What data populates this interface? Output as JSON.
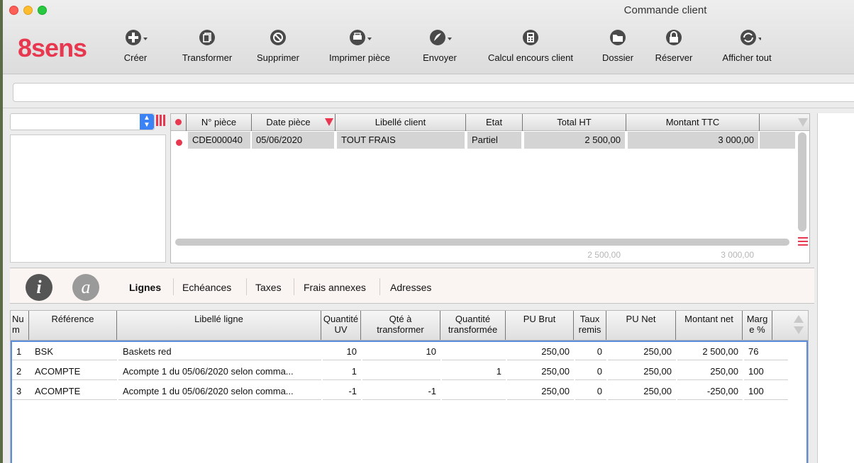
{
  "window": {
    "title": "Commande client"
  },
  "brand": {
    "logo": "8sens",
    "color": "#e8384f"
  },
  "toolbar": [
    {
      "id": "creer",
      "label": "Créer",
      "icon": "plus-circle-icon"
    },
    {
      "id": "transformer",
      "label": "Transformer",
      "icon": "copy-icon"
    },
    {
      "id": "supprimer",
      "label": "Supprimer",
      "icon": "forbidden-icon"
    },
    {
      "id": "imprimer",
      "label": "Imprimer pièce",
      "icon": "printer-icon"
    },
    {
      "id": "envoyer",
      "label": "Envoyer",
      "icon": "send-icon"
    },
    {
      "id": "calcul",
      "label": "Calcul encours client",
      "icon": "calculator-icon"
    },
    {
      "id": "dossier",
      "label": "Dossier",
      "icon": "folder-icon"
    },
    {
      "id": "reserver",
      "label": "Réserver",
      "icon": "lock-icon"
    },
    {
      "id": "afficher",
      "label": "Afficher tout",
      "icon": "refresh-icon"
    }
  ],
  "search": {
    "value": ""
  },
  "filter": {
    "selected": ""
  },
  "orders": {
    "columns": [
      "N° pièce",
      "Date pièce",
      "Libellé client",
      "Etat",
      "Total HT",
      "Montant TTC"
    ],
    "rows": [
      {
        "num": "CDE000040",
        "date": "05/06/2020",
        "client": "TOUT FRAIS",
        "etat": "Partiel",
        "ht": "2 500,00",
        "ttc": "3 000,00"
      }
    ],
    "totals": {
      "ht": "2 500,00",
      "ttc": "3 000,00"
    }
  },
  "tabs": [
    {
      "label": "Lignes",
      "active": true
    },
    {
      "label": "Echéances",
      "active": false
    },
    {
      "label": "Taxes",
      "active": false
    },
    {
      "label": "Frais annexes",
      "active": false
    },
    {
      "label": "Adresses",
      "active": false
    }
  ],
  "info_buttons": {
    "i": "i",
    "a": "a"
  },
  "lines": {
    "columns": [
      {
        "l1": "Nu",
        "l2": "m"
      },
      {
        "l1": "Référence",
        "l2": ""
      },
      {
        "l1": "Libellé ligne",
        "l2": ""
      },
      {
        "l1": "Quantité",
        "l2": "UV"
      },
      {
        "l1": "Qté à",
        "l2": "transformer"
      },
      {
        "l1": "Quantité",
        "l2": "transformée"
      },
      {
        "l1": "PU Brut",
        "l2": ""
      },
      {
        "l1": "Taux",
        "l2": "remis"
      },
      {
        "l1": "PU Net",
        "l2": ""
      },
      {
        "l1": "Montant net",
        "l2": ""
      },
      {
        "l1": "Marg",
        "l2": "e %"
      }
    ],
    "rows": [
      {
        "num": "1",
        "ref": "BSK",
        "lib": "Baskets red",
        "qte": "10",
        "qtt": "10",
        "qtf": "",
        "pub": "250,00",
        "taux": "0",
        "pun": "250,00",
        "mnt": "2 500,00",
        "marge": "76"
      },
      {
        "num": "2",
        "ref": "ACOMPTE",
        "lib": "Acompte 1 du 05/06/2020 selon comma...",
        "qte": "1",
        "qtt": "",
        "qtf": "1",
        "pub": "250,00",
        "taux": "0",
        "pun": "250,00",
        "mnt": "250,00",
        "marge": "100"
      },
      {
        "num": "3",
        "ref": "ACOMPTE",
        "lib": "Acompte 1 du 05/06/2020 selon comma...",
        "qte": "-1",
        "qtt": "-1",
        "qtf": "",
        "pub": "250,00",
        "taux": "0",
        "pun": "250,00",
        "mnt": "-250,00",
        "marge": "100"
      }
    ]
  }
}
